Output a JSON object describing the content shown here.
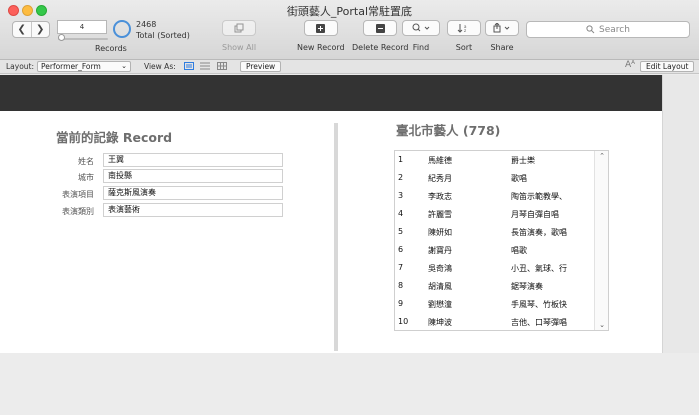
{
  "window": {
    "title": "街頭藝人_Portal常駐置底"
  },
  "toolbar": {
    "record_number": "4",
    "total_count": "2468",
    "total_label": "Total (Sorted)",
    "records_label": "Records",
    "show_all": "Show All",
    "new_record": "New Record",
    "delete_record": "Delete Record",
    "find": "Find",
    "sort": "Sort",
    "share": "Share",
    "search_placeholder": "Search"
  },
  "layout_bar": {
    "layout_label": "Layout:",
    "layout_value": "Performer_Form",
    "view_as_label": "View As:",
    "preview": "Preview",
    "aa": "Aᴬ",
    "edit_layout": "Edit Layout"
  },
  "current_record": {
    "title": "當前的記錄 Record",
    "fields": [
      {
        "label": "姓名",
        "value": "王翼"
      },
      {
        "label": "城市",
        "value": "南投縣"
      },
      {
        "label": "表演項目",
        "value": "薩克斯風演奏"
      },
      {
        "label": "表演類別",
        "value": "表演藝術"
      }
    ]
  },
  "portal": {
    "title": "臺北市藝人 (778)",
    "rows": [
      {
        "n": "1",
        "name": "馬維德",
        "performance": "爵士樂"
      },
      {
        "n": "2",
        "name": "紀秀月",
        "performance": "歌唱"
      },
      {
        "n": "3",
        "name": "李政志",
        "performance": "陶笛示範教學、"
      },
      {
        "n": "4",
        "name": "許麗雪",
        "performance": "月琴自彈自唱"
      },
      {
        "n": "5",
        "name": "陳妍如",
        "performance": "長笛演奏，歌唱"
      },
      {
        "n": "6",
        "name": "謝寶丹",
        "performance": "唱歌"
      },
      {
        "n": "7",
        "name": "吳奇鴻",
        "performance": "小丑、氣球、行"
      },
      {
        "n": "8",
        "name": "胡清風",
        "performance": "鋸琴演奏"
      },
      {
        "n": "9",
        "name": "劉懋潼",
        "performance": "手風琴、竹板快"
      },
      {
        "n": "10",
        "name": "陳坤波",
        "performance": "吉他、口琴彈唱"
      }
    ]
  },
  "colors": {
    "header_band": "#333333",
    "accent_blue": "#4a90d9"
  }
}
